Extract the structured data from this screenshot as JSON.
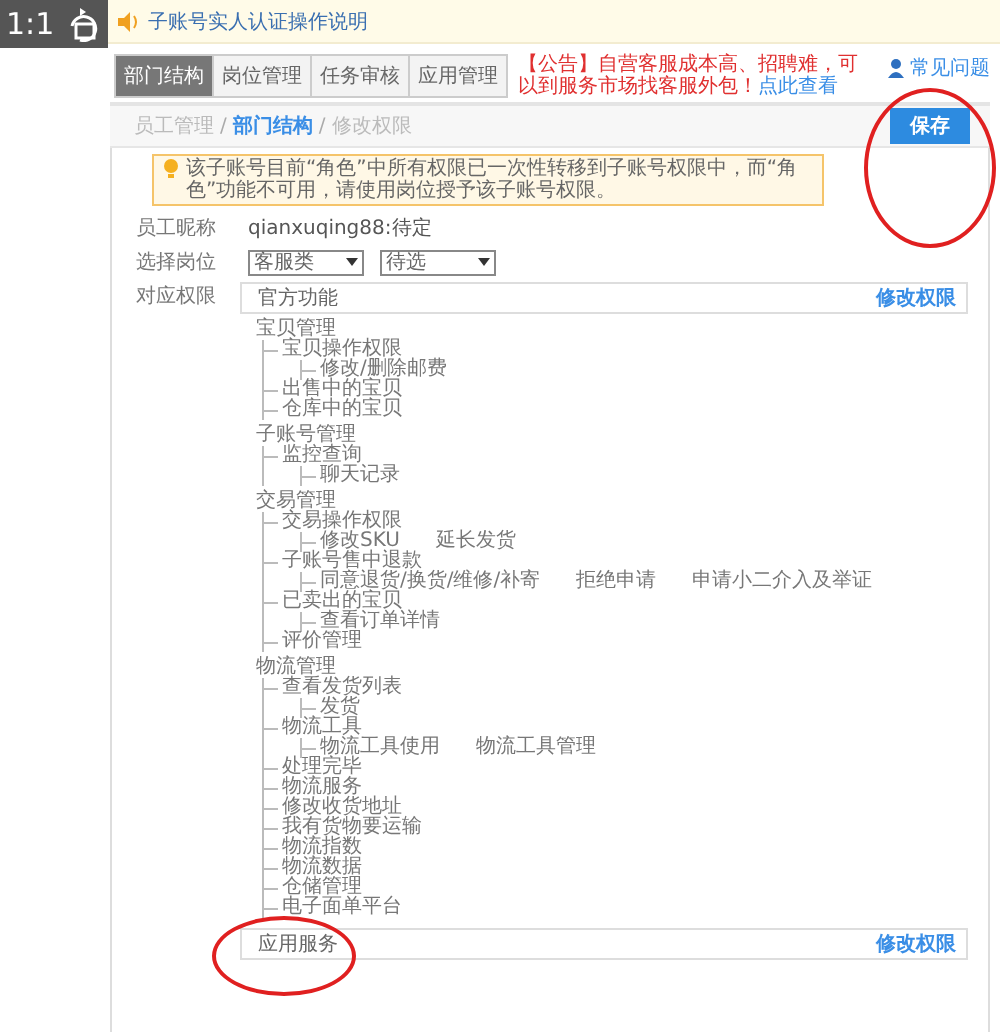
{
  "viewer": {
    "zoom_label": "1:1"
  },
  "banner": {
    "text": "子账号实人认证操作说明"
  },
  "tabs": [
    {
      "label": "部门结构",
      "selected": true
    },
    {
      "label": "岗位管理",
      "selected": false
    },
    {
      "label": "任务审核",
      "selected": false
    },
    {
      "label": "应用管理",
      "selected": false
    }
  ],
  "notice": {
    "text": "【公告】自营客服成本高、招聘难，可以到服务市场找客服外包！",
    "link": "点此查看"
  },
  "help_link": "常见问题",
  "breadcrumb_separator": "/",
  "breadcrumb": [
    {
      "label": "员工管理",
      "active": false
    },
    {
      "label": "部门结构",
      "active": true
    },
    {
      "label": "修改权限",
      "active": false
    }
  ],
  "save_button": {
    "label": "保存",
    "circled": true
  },
  "tip": "该子账号目前“角色”中所有权限已一次性转移到子账号权限中，而“角色”功能不可用，请使用岗位授予该子账号权限。",
  "form": {
    "nickname_label": "员工昵称",
    "nickname": "qianxuqing88:待定",
    "position_label": "选择岗位",
    "position_selects": [
      "客服类",
      "待选"
    ],
    "permissions_label": "对应权限"
  },
  "panels": [
    {
      "title": "官方功能",
      "action": "修改权限",
      "circled": false,
      "tree": [
        {
          "label": "宝贝管理",
          "children": [
            {
              "label": "宝贝操作权限",
              "children": [
                {
                  "label": "修改/删除邮费"
                }
              ]
            },
            {
              "label": "出售中的宝贝"
            },
            {
              "label": "仓库中的宝贝"
            }
          ]
        },
        {
          "label": "子账号管理",
          "children": [
            {
              "label": "监控查询",
              "children": [
                {
                  "label": "聊天记录"
                }
              ]
            }
          ]
        },
        {
          "label": "交易管理",
          "children": [
            {
              "label": "交易操作权限",
              "children": [
                {
                  "label": "修改SKU"
                },
                {
                  "label": "延长发货"
                }
              ]
            },
            {
              "label": "子账号售中退款",
              "children": [
                {
                  "label": "同意退货/换货/维修/补寄"
                },
                {
                  "label": "拒绝申请"
                },
                {
                  "label": "申请小二介入及举证"
                }
              ]
            },
            {
              "label": "已卖出的宝贝",
              "children": [
                {
                  "label": "查看订单详情"
                }
              ]
            },
            {
              "label": "评价管理"
            }
          ]
        },
        {
          "label": "物流管理",
          "children": [
            {
              "label": "查看发货列表",
              "children": [
                {
                  "label": "发货"
                }
              ]
            },
            {
              "label": "物流工具",
              "children": [
                {
                  "label": "物流工具使用"
                },
                {
                  "label": "物流工具管理"
                }
              ]
            },
            {
              "label": "处理完毕"
            },
            {
              "label": "物流服务"
            },
            {
              "label": "修改收货地址"
            },
            {
              "label": "我有货物要运输"
            },
            {
              "label": "物流指数"
            },
            {
              "label": "物流数据"
            },
            {
              "label": "仓储管理"
            },
            {
              "label": "电子面单平台"
            }
          ]
        }
      ]
    },
    {
      "title": "应用服务",
      "action": "修改权限",
      "circled": true
    }
  ]
}
